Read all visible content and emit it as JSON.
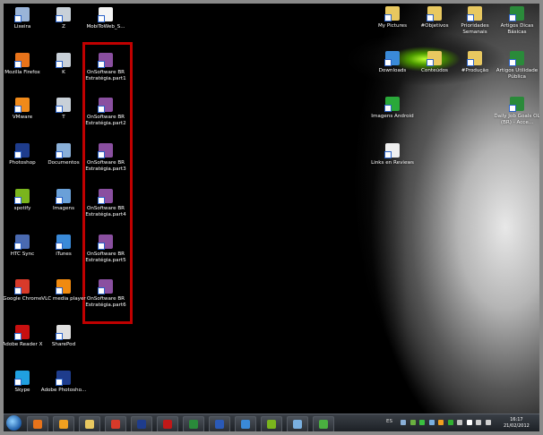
{
  "desktop": {
    "left_icons": [
      {
        "label": "Lixeira",
        "icon": "recycle-bin-icon",
        "color": "#9ab4d8"
      },
      {
        "label": "Z",
        "icon": "network-drive-icon",
        "color": "#c8d0d8"
      },
      {
        "label": "MobiToWeb_S...",
        "icon": "file-icon",
        "color": "#f4f4f4"
      },
      {
        "label": "Mozilla Firefox",
        "icon": "firefox-icon",
        "color": "#e8731a"
      },
      {
        "label": "K",
        "icon": "network-drive-icon",
        "color": "#c8d0d8"
      },
      {
        "label": "OnSoftware BR Estratégia.part1",
        "icon": "winrar-archive-icon",
        "color": "#8a4fa0"
      },
      {
        "label": "VMware",
        "icon": "vmware-icon",
        "color": "#f08a1a"
      },
      {
        "label": "T",
        "icon": "network-drive-icon",
        "color": "#c8d0d8"
      },
      {
        "label": "OnSoftware BR Estratégia.part2",
        "icon": "winrar-archive-icon",
        "color": "#8a4fa0"
      },
      {
        "label": "Photoshop",
        "icon": "photoshop-icon",
        "color": "#1e3c8c"
      },
      {
        "label": "Documentos",
        "icon": "documents-library-icon",
        "color": "#8ab0d8"
      },
      {
        "label": "OnSoftware BR Estratégia.part3",
        "icon": "winrar-archive-icon",
        "color": "#8a4fa0"
      },
      {
        "label": "spotify",
        "icon": "spotify-icon",
        "color": "#7ab51d"
      },
      {
        "label": "Imagens",
        "icon": "pictures-library-icon",
        "color": "#6aa0d8"
      },
      {
        "label": "OnSoftware BR Estratégia.part4",
        "icon": "winrar-archive-icon",
        "color": "#8a4fa0"
      },
      {
        "label": "HTC Sync",
        "icon": "htc-sync-icon",
        "color": "#4a6ab0"
      },
      {
        "label": "iTunes",
        "icon": "itunes-icon",
        "color": "#3a8ad8"
      },
      {
        "label": "OnSoftware BR Estratégia.part5",
        "icon": "winrar-archive-icon",
        "color": "#8a4fa0"
      },
      {
        "label": "Google Chrome",
        "icon": "chrome-icon",
        "color": "#d83a2a"
      },
      {
        "label": "VLC media player",
        "icon": "vlc-icon",
        "color": "#f08a10"
      },
      {
        "label": "OnSoftware BR Estratégia.part6",
        "icon": "winrar-archive-icon",
        "color": "#8a4fa0"
      },
      {
        "label": "Adobe Reader X",
        "icon": "adobe-reader-icon",
        "color": "#c81010"
      },
      {
        "label": "SharePod",
        "icon": "sharepod-icon",
        "color": "#e0e0e0"
      },
      null,
      {
        "label": "Skype",
        "icon": "skype-icon",
        "color": "#20a0e0"
      },
      {
        "label": "Adobe Photosho...",
        "icon": "photoshop-icon",
        "color": "#1e3c8c"
      }
    ],
    "right_icons": [
      {
        "label": "My Pictures",
        "icon": "folder-icon",
        "color": "#e8c860"
      },
      {
        "label": "#Objetivos",
        "icon": "folder-icon",
        "color": "#e8c860"
      },
      {
        "label": "Prioridades Semanais",
        "icon": "folder-icon",
        "color": "#e8c860"
      },
      {
        "label": "Artigos Dicas Básicas",
        "icon": "excel-file-icon",
        "color": "#2a8a3a"
      },
      {
        "label": "Downloads",
        "icon": "downloads-icon",
        "color": "#3a8ad8"
      },
      {
        "label": "Conteúdos",
        "icon": "folder-icon",
        "color": "#e8c860"
      },
      {
        "label": "#Produção",
        "icon": "folder-icon",
        "color": "#e8c860"
      },
      {
        "label": "Artigos Utilidade Pública",
        "icon": "excel-file-icon",
        "color": "#2a8a3a"
      },
      {
        "label": "Imagens Android",
        "icon": "android-images-icon",
        "color": "#2aa83a"
      },
      null,
      null,
      {
        "label": "Daily Job Goals OL (BR) - Acce...",
        "icon": "excel-file-icon",
        "color": "#2a8a3a"
      },
      {
        "label": "Links en Reviews",
        "icon": "text-file-icon",
        "color": "#f0f0f0"
      }
    ]
  },
  "taskbar": {
    "pinned": [
      {
        "name": "firefox",
        "color": "#e8731a"
      },
      {
        "name": "outlook",
        "color": "#f0a020"
      },
      {
        "name": "windows-explorer",
        "color": "#e8c860"
      },
      {
        "name": "chrome",
        "color": "#d83a2a"
      },
      {
        "name": "photoshop",
        "color": "#1e3c8c"
      },
      {
        "name": "filezilla",
        "color": "#c01818"
      },
      {
        "name": "excel",
        "color": "#2a8a3a"
      },
      {
        "name": "word",
        "color": "#2a5ab8"
      },
      {
        "name": "lync",
        "color": "#3a8ad8"
      },
      {
        "name": "spotify",
        "color": "#7ab51d"
      },
      {
        "name": "notes",
        "color": "#7ab0e0"
      },
      {
        "name": "messenger",
        "color": "#4ab040"
      }
    ],
    "language": "ES",
    "tray_colors": [
      "#8ab0d8",
      "#6ab040",
      "#3ac040",
      "#7ab0e0",
      "#f0a020",
      "#30b030",
      "#c0c0c0",
      "#ffffff",
      "#d0d0d0",
      "#d0d0d0"
    ],
    "time": "16:17",
    "date": "21/02/2012"
  }
}
